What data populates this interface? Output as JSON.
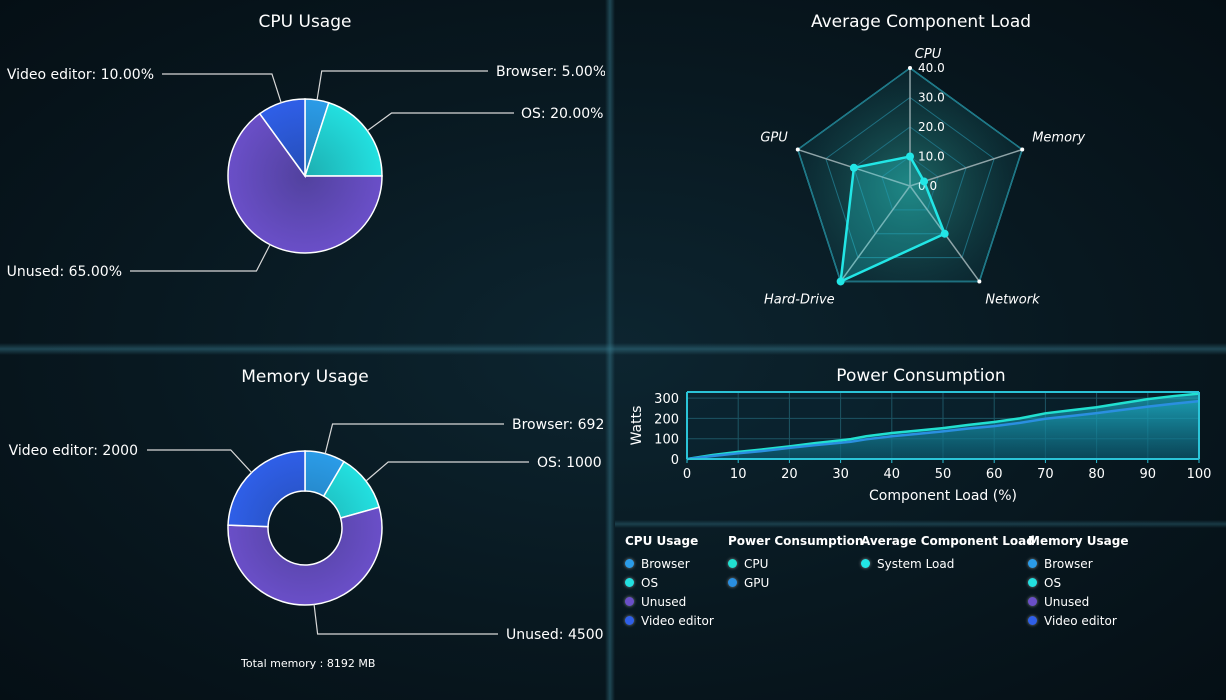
{
  "colors": {
    "browser": "#2b9ce8",
    "os": "#23e0e0",
    "unused": "#6a4fc8",
    "video_editor": "#2f5fe8",
    "cpu_line": "#21e0d0",
    "gpu_line": "#2a8fe0",
    "radar": "#22e6e6"
  },
  "total_memory": "Total memory : 8192 MB",
  "chart_data": [
    {
      "type": "pie",
      "title": "CPU Usage",
      "slices": [
        {
          "name": "Browser",
          "value": 5,
          "label": "Browser: 5.00%",
          "color_key": "browser"
        },
        {
          "name": "OS",
          "value": 20,
          "label": "OS: 20.00%",
          "color_key": "os"
        },
        {
          "name": "Unused",
          "value": 65,
          "label": "Unused: 65.00%",
          "color_key": "unused"
        },
        {
          "name": "Video editor",
          "value": 10,
          "label": "Video editor: 10.00%",
          "color_key": "video_editor"
        }
      ]
    },
    {
      "type": "radar",
      "title": "Average Component Load",
      "axes": [
        "CPU",
        "Memory",
        "Network",
        "Hard-Drive",
        "GPU"
      ],
      "ticks": [
        "0.0",
        "10.0",
        "20.0",
        "30.0",
        "40.0"
      ],
      "range": [
        0,
        40
      ],
      "series": [
        {
          "name": "System Load",
          "values": [
            10,
            5,
            20,
            40,
            20
          ]
        }
      ]
    },
    {
      "type": "pie",
      "subtype": "donut",
      "title": "Memory Usage",
      "slices": [
        {
          "name": "Browser",
          "value": 692,
          "label": "Browser: 692",
          "color_key": "browser"
        },
        {
          "name": "OS",
          "value": 1000,
          "label": "OS: 1000",
          "color_key": "os"
        },
        {
          "name": "Unused",
          "value": 4500,
          "label": "Unused: 4500",
          "color_key": "unused"
        },
        {
          "name": "Video editor",
          "value": 2000,
          "label": "Video editor: 2000",
          "color_key": "video_editor"
        }
      ]
    },
    {
      "type": "area",
      "title": "Power Consumption",
      "xlabel": "Component Load (%)",
      "ylabel": "Watts",
      "xlim": [
        0,
        100
      ],
      "ylim": [
        0,
        330
      ],
      "xticks": [
        "0",
        "10",
        "20",
        "30",
        "40",
        "50",
        "60",
        "70",
        "80",
        "90",
        "100"
      ],
      "yticks": [
        "0",
        "100",
        "200",
        "300"
      ],
      "x": [
        0,
        5,
        10,
        15,
        20,
        25,
        30,
        32,
        35,
        40,
        45,
        50,
        55,
        60,
        65,
        68,
        70,
        75,
        80,
        85,
        90,
        95,
        100
      ],
      "series": [
        {
          "name": "CPU",
          "values": [
            0,
            20,
            35,
            48,
            62,
            78,
            92,
            98,
            112,
            128,
            140,
            152,
            168,
            182,
            200,
            215,
            225,
            240,
            255,
            275,
            295,
            310,
            322
          ]
        },
        {
          "name": "GPU",
          "values": [
            0,
            15,
            28,
            40,
            55,
            68,
            80,
            85,
            97,
            112,
            124,
            136,
            150,
            162,
            178,
            190,
            198,
            212,
            226,
            242,
            258,
            272,
            285
          ]
        }
      ]
    }
  ],
  "legend": [
    {
      "title": "CPU Usage",
      "items": [
        {
          "label": "Browser",
          "color_key": "browser"
        },
        {
          "label": "OS",
          "color_key": "os"
        },
        {
          "label": "Unused",
          "color_key": "unused"
        },
        {
          "label": "Video editor",
          "color_key": "video_editor"
        }
      ]
    },
    {
      "title": "Power Consumption",
      "items": [
        {
          "label": "CPU",
          "color_key": "cpu_line"
        },
        {
          "label": "GPU",
          "color_key": "gpu_line"
        }
      ]
    },
    {
      "title": "Average Component Load",
      "items": [
        {
          "label": "System Load",
          "color_key": "radar"
        }
      ]
    },
    {
      "title": "Memory Usage",
      "items": [
        {
          "label": "Browser",
          "color_key": "browser"
        },
        {
          "label": "OS",
          "color_key": "os"
        },
        {
          "label": "Unused",
          "color_key": "unused"
        },
        {
          "label": "Video editor",
          "color_key": "video_editor"
        }
      ]
    }
  ]
}
